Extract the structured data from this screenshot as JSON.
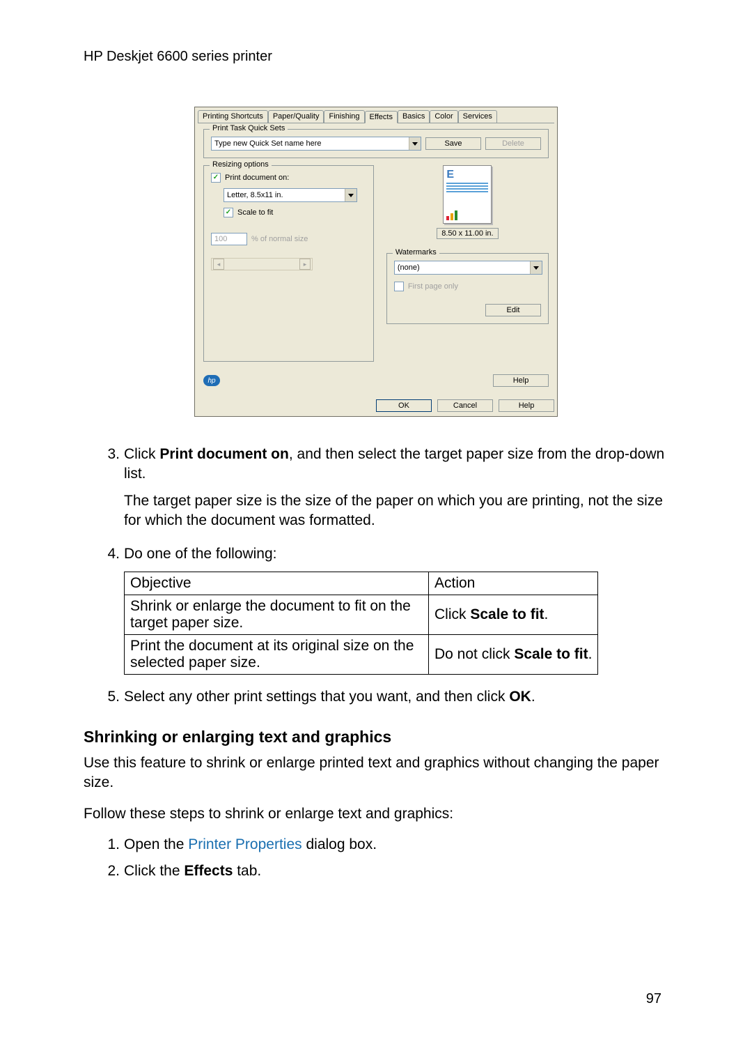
{
  "header": "HP Deskjet 6600 series printer",
  "dialog": {
    "tabs": [
      "Printing Shortcuts",
      "Paper/Quality",
      "Finishing",
      "Effects",
      "Basics",
      "Color",
      "Services"
    ],
    "active_tab_index": 3,
    "quicksets": {
      "legend": "Print Task Quick Sets",
      "placeholder": "Type new Quick Set name here",
      "save": "Save",
      "delete": "Delete"
    },
    "resizing": {
      "legend": "Resizing options",
      "print_doc_on": "Print document on:",
      "paper_size": "Letter, 8.5x11 in.",
      "scale_to_fit": "Scale to fit",
      "pct_value": "100",
      "pct_label": "% of normal size"
    },
    "preview_size": "8.50 x 11.00 in.",
    "watermarks": {
      "legend": "Watermarks",
      "value": "(none)",
      "first_page_only": "First page only",
      "edit": "Edit"
    },
    "help": "Help",
    "footer": {
      "ok": "OK",
      "cancel": "Cancel",
      "help": "Help"
    }
  },
  "step3": {
    "num": "3.",
    "pre": "Click ",
    "bold": "Print document on",
    "post": ", and then select the target paper size from the drop-down list.",
    "note": "The target paper size is the size of the paper on which you are printing, not the size for which the document was formatted."
  },
  "step4": {
    "num": "4.",
    "text": "Do one of the following:",
    "table": {
      "h_obj": "Objective",
      "h_act": "Action",
      "r1_obj": "Shrink or enlarge the document to fit on the target paper size.",
      "r1_act_pre": "Click ",
      "r1_act_bold": "Scale to fit",
      "r1_act_post": ".",
      "r2_obj": "Print the document at its original size on the selected paper size.",
      "r2_act_pre": "Do not click ",
      "r2_act_bold": "Scale to fit",
      "r2_act_post": "."
    }
  },
  "step5": {
    "num": "5.",
    "pre": "Select any other print settings that you want, and then click ",
    "bold": "OK",
    "post": "."
  },
  "section_heading": "Shrinking or enlarging text and graphics",
  "section_p1": "Use this feature to shrink or enlarge printed text and graphics without changing the paper size.",
  "section_p2": "Follow these steps to shrink or enlarge text and graphics:",
  "sub1": {
    "num": "1.",
    "pre": "Open the ",
    "link": "Printer Properties",
    "post": " dialog box."
  },
  "sub2": {
    "num": "2.",
    "pre": "Click the ",
    "bold": "Effects",
    "post": " tab."
  },
  "page_number": "97"
}
